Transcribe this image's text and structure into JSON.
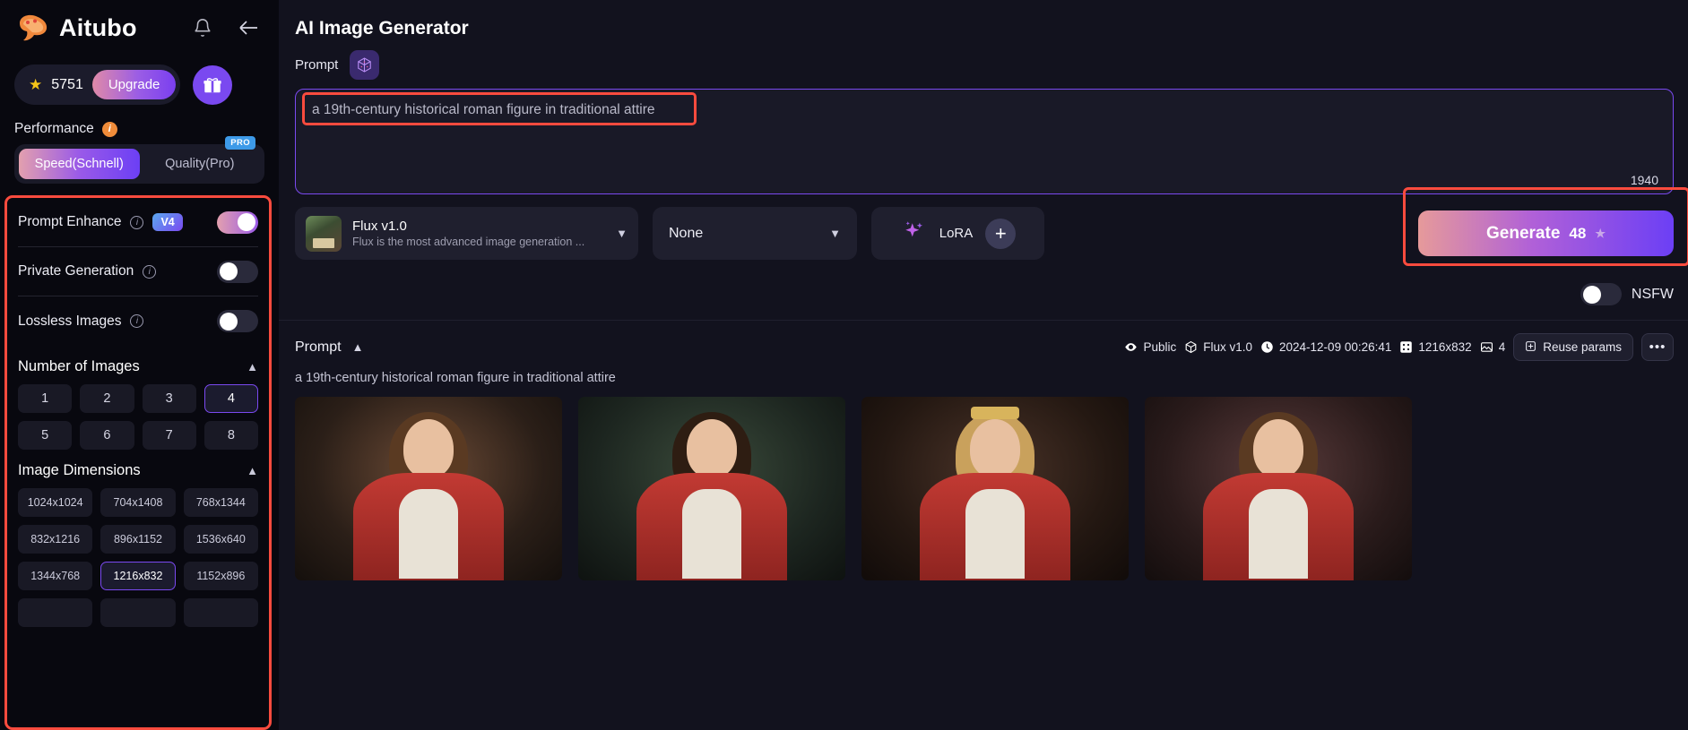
{
  "sidebar": {
    "brand": "Aitubo",
    "icons": {
      "bell": "bell-icon",
      "back": "back-arrow-icon",
      "gift": "gift-icon"
    },
    "credits": {
      "value": "5751",
      "star": "★",
      "upgrade_label": "Upgrade"
    },
    "performance": {
      "label": "Performance",
      "info": "i",
      "options": [
        {
          "label": "Speed(Schnell)",
          "active": true,
          "badge": ""
        },
        {
          "label": "Quality(Pro)",
          "active": false,
          "badge": "PRO"
        }
      ]
    },
    "toggles": [
      {
        "label": "Prompt Enhance",
        "badge": "V4",
        "state": "on"
      },
      {
        "label": "Private Generation",
        "badge": "",
        "state": "off"
      },
      {
        "label": "Lossless Images",
        "badge": "",
        "state": "off"
      }
    ],
    "number_of_images": {
      "title": "Number of Images",
      "options": [
        "1",
        "2",
        "3",
        "4",
        "5",
        "6",
        "7",
        "8"
      ],
      "selected": "4"
    },
    "image_dimensions": {
      "title": "Image Dimensions",
      "options": [
        "1024x1024",
        "704x1408",
        "768x1344",
        "832x1216",
        "896x1152",
        "1536x640",
        "1344x768",
        "1216x832",
        "1152x896"
      ],
      "selected": "1216x832"
    }
  },
  "main": {
    "page_title": "AI Image Generator",
    "prompt_section": {
      "label": "Prompt",
      "dice_icon": "dice-icon",
      "value": "a 19th-century historical roman figure in traditional attire",
      "char_count": "1940"
    },
    "controls": {
      "model": {
        "name": "Flux v1.0",
        "description": "Flux is the most advanced image generation ..."
      },
      "style_select": {
        "value": "None"
      },
      "lora": {
        "label": "LoRA",
        "plus": "+"
      },
      "generate": {
        "label": "Generate",
        "cost": "48",
        "star": "★"
      }
    },
    "nsfw": {
      "label": "NSFW",
      "state": "off"
    }
  },
  "history": {
    "prompt_label": "Prompt",
    "prompt_text": "a 19th-century historical roman figure in traditional attire",
    "meta": {
      "visibility": "Public",
      "model": "Flux v1.0",
      "timestamp": "2024-12-09 00:26:41",
      "dimensions": "1216x832",
      "count": "4",
      "reuse_label": "Reuse params",
      "more_label": "•••"
    },
    "thumbnails": [
      {
        "alt": "generated-image-1"
      },
      {
        "alt": "generated-image-2"
      },
      {
        "alt": "generated-image-3"
      },
      {
        "alt": "generated-image-4"
      }
    ]
  },
  "colors": {
    "accent_purple": "#7a49f0",
    "highlight_red": "#fa4b3e",
    "bg_dark": "#06060e",
    "panel": "#12121e"
  }
}
